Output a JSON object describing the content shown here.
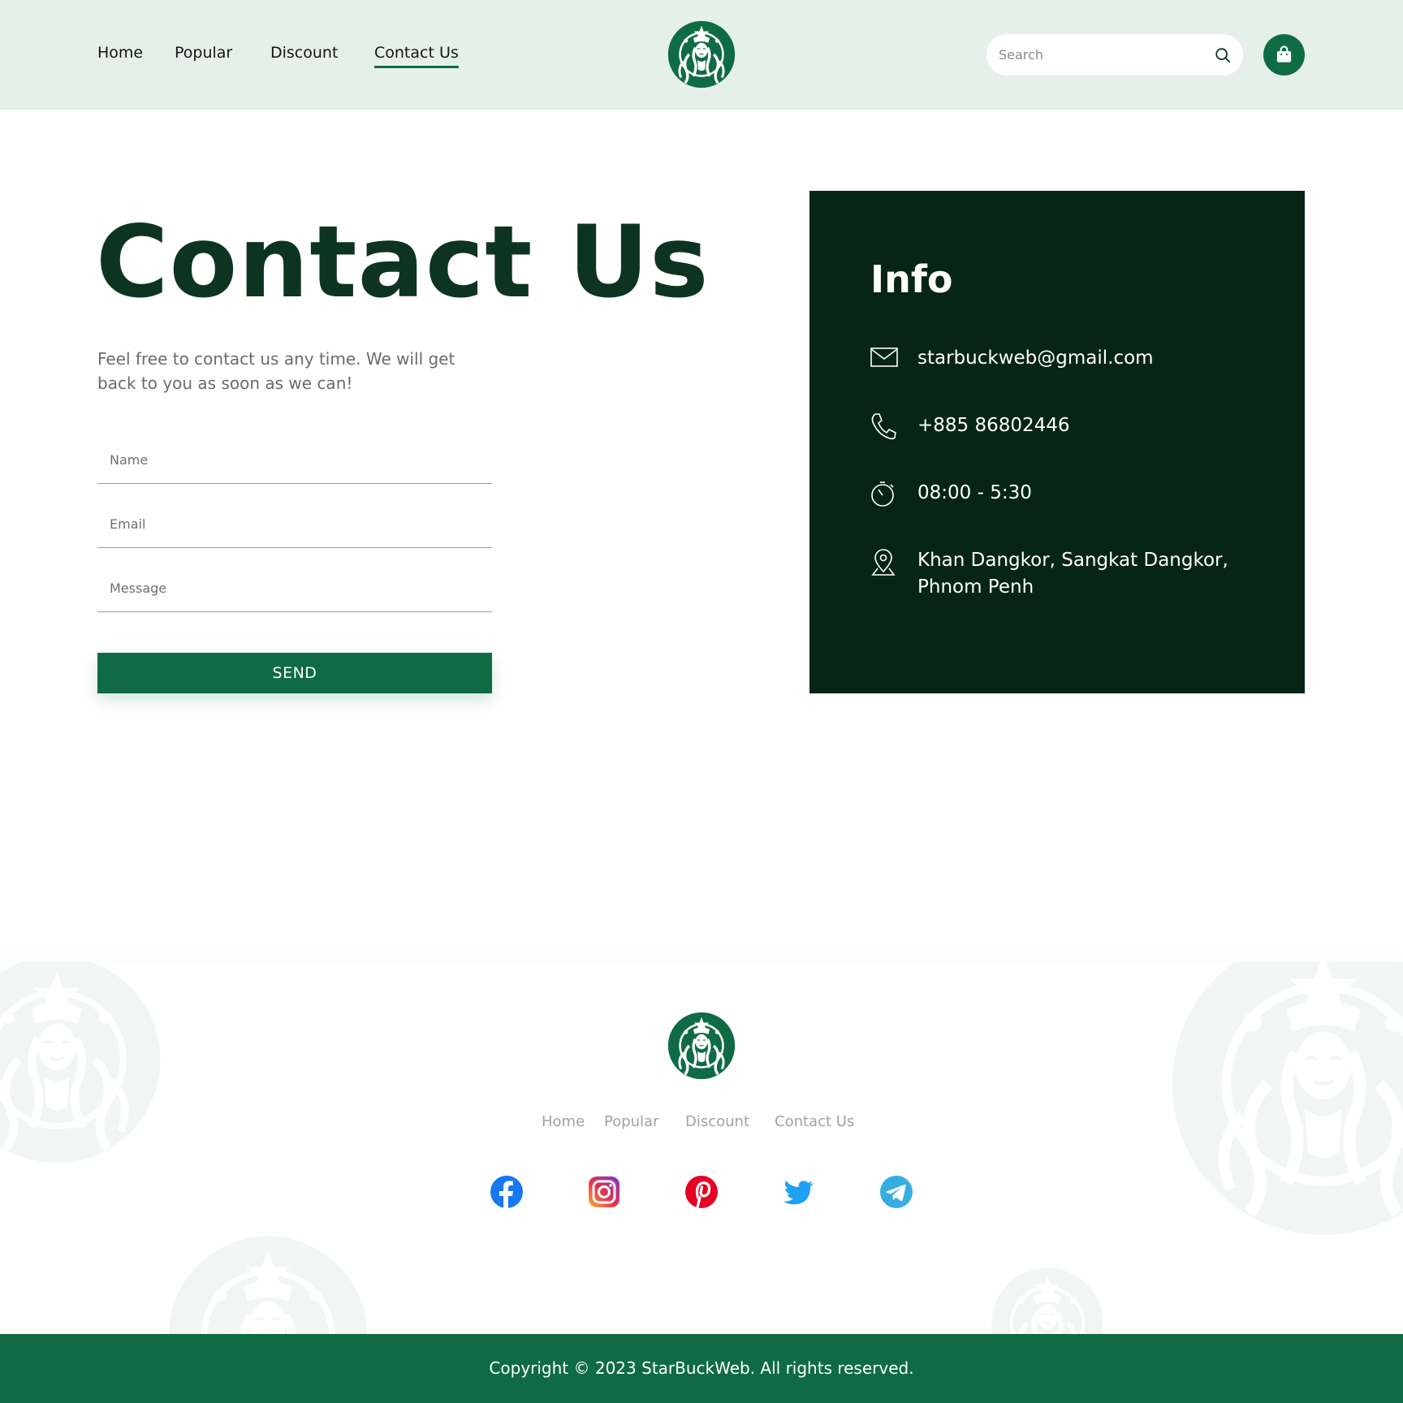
{
  "colors": {
    "brand": "#0f6b44",
    "dark": "#072517",
    "title": "#0d3420",
    "header_bg": "#e6f0ea"
  },
  "header": {
    "nav": [
      {
        "label": "Home",
        "active": false
      },
      {
        "label": "Popular",
        "active": false
      },
      {
        "label": "Discount",
        "active": false
      },
      {
        "label": "Contact Us",
        "active": true
      }
    ],
    "logo_icon": "siren-logo-icon",
    "search": {
      "placeholder": "Search",
      "value": "",
      "icon": "search-icon"
    },
    "cart_icon": "shopping-bag-icon"
  },
  "main": {
    "title": "Contact Us",
    "lead": "Feel free to contact us any time. We will get back to you as soon as we can!",
    "form": {
      "name_placeholder": "Name",
      "email_placeholder": "Email",
      "message_placeholder": "Message",
      "send_label": "SEND"
    }
  },
  "info": {
    "heading": "Info",
    "email": "starbuckweb@gmail.com",
    "phone": "+885 86802446",
    "hours": "08:00 - 5:30",
    "address": "Khan Dangkor, Sangkat Dangkor, Phnom  Penh",
    "icons": [
      "mail-icon",
      "phone-icon",
      "stopwatch-icon",
      "location-pin-icon"
    ]
  },
  "footer": {
    "nav": [
      "Home",
      "Popular",
      "Discount",
      "Contact Us"
    ],
    "social": [
      "facebook-icon",
      "instagram-icon",
      "pinterest-icon",
      "twitter-icon",
      "telegram-icon"
    ],
    "copyright": "Copyright © 2023 StarBuckWeb. All rights reserved."
  }
}
